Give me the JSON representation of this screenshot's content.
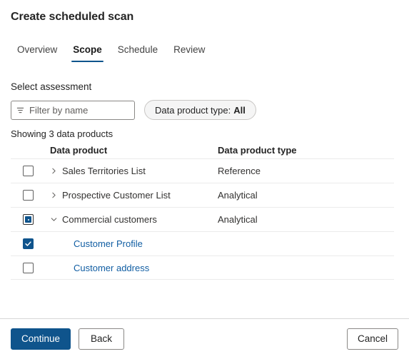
{
  "page": {
    "title": "Create scheduled scan"
  },
  "tabs": [
    {
      "label": "Overview",
      "active": false
    },
    {
      "label": "Scope",
      "active": true
    },
    {
      "label": "Schedule",
      "active": false
    },
    {
      "label": "Review",
      "active": false
    }
  ],
  "assessment": {
    "section_label": "Select assessment",
    "filter": {
      "icon": "filter-icon",
      "placeholder": "Filter by name",
      "value": ""
    },
    "type_pill": {
      "label": "Data product type:",
      "value": "All"
    },
    "showing_count": "Showing 3 data products"
  },
  "table": {
    "headers": {
      "data_product": "Data product",
      "data_product_type": "Data product type"
    },
    "rows": [
      {
        "name": "Sales Territories List",
        "type": "Reference",
        "checkbox": "unchecked",
        "expand": "collapsed",
        "level": "parent",
        "link": false
      },
      {
        "name": "Prospective Customer List",
        "type": "Analytical",
        "checkbox": "unchecked",
        "expand": "collapsed",
        "level": "parent",
        "link": false
      },
      {
        "name": "Commercial customers",
        "type": "Analytical",
        "checkbox": "indeterminate",
        "expand": "expanded",
        "level": "parent",
        "link": false
      },
      {
        "name": "Customer Profile",
        "type": "",
        "checkbox": "checked",
        "expand": "none",
        "level": "child",
        "link": true
      },
      {
        "name": "Customer address",
        "type": "",
        "checkbox": "unchecked",
        "expand": "none",
        "level": "child",
        "link": true
      }
    ]
  },
  "footer": {
    "continue_label": "Continue",
    "back_label": "Back",
    "cancel_label": "Cancel"
  },
  "colors": {
    "accent": "#0f548c",
    "link": "#115ea3",
    "divider": "#ebebeb",
    "pill_bg": "#f5f5f5",
    "text": "#242424"
  }
}
